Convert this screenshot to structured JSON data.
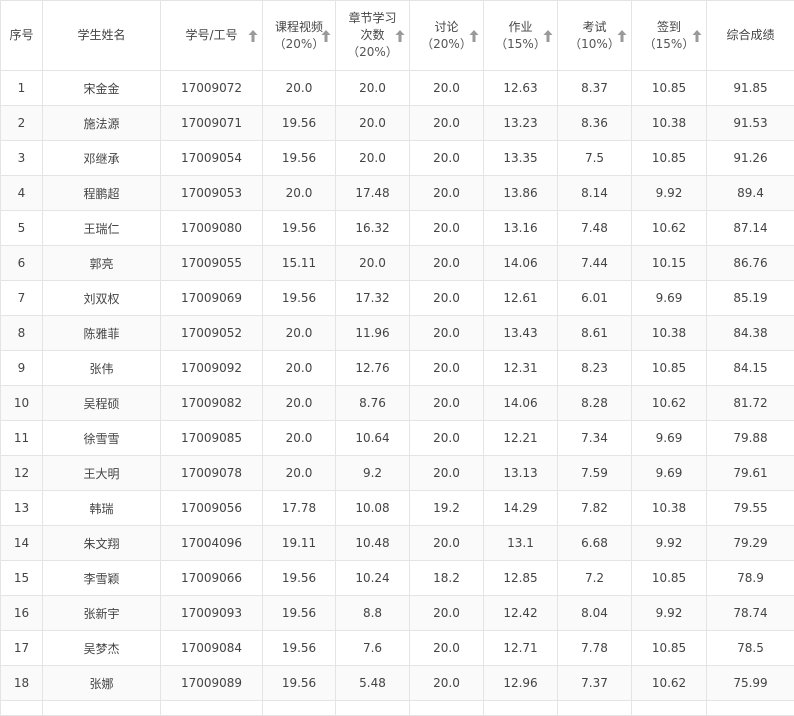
{
  "table": {
    "columns": [
      {
        "label": "序号",
        "sortable": false
      },
      {
        "label": "学生姓名",
        "sortable": false
      },
      {
        "label": "学号/工号",
        "sortable": true
      },
      {
        "label": "课程视频",
        "sub": "（20%）",
        "sortable": true
      },
      {
        "label": "章节学习次数",
        "sub": "（20%）",
        "sortable": true
      },
      {
        "label": "讨论",
        "sub": "（20%）",
        "sortable": true
      },
      {
        "label": "作业",
        "sub": "（15%）",
        "sortable": true
      },
      {
        "label": "考试",
        "sub": "（10%）",
        "sortable": true
      },
      {
        "label": "签到",
        "sub": "（15%）",
        "sortable": true
      },
      {
        "label": "综合成绩",
        "sortable": false
      }
    ],
    "rows": [
      [
        "1",
        "宋金金",
        "17009072",
        "20.0",
        "20.0",
        "20.0",
        "12.63",
        "8.37",
        "10.85",
        "91.85"
      ],
      [
        "2",
        "施法源",
        "17009071",
        "19.56",
        "20.0",
        "20.0",
        "13.23",
        "8.36",
        "10.38",
        "91.53"
      ],
      [
        "3",
        "邓继承",
        "17009054",
        "19.56",
        "20.0",
        "20.0",
        "13.35",
        "7.5",
        "10.85",
        "91.26"
      ],
      [
        "4",
        "程鹏超",
        "17009053",
        "20.0",
        "17.48",
        "20.0",
        "13.86",
        "8.14",
        "9.92",
        "89.4"
      ],
      [
        "5",
        "王瑞仁",
        "17009080",
        "19.56",
        "16.32",
        "20.0",
        "13.16",
        "7.48",
        "10.62",
        "87.14"
      ],
      [
        "6",
        "郭亮",
        "17009055",
        "15.11",
        "20.0",
        "20.0",
        "14.06",
        "7.44",
        "10.15",
        "86.76"
      ],
      [
        "7",
        "刘双权",
        "17009069",
        "19.56",
        "17.32",
        "20.0",
        "12.61",
        "6.01",
        "9.69",
        "85.19"
      ],
      [
        "8",
        "陈雅菲",
        "17009052",
        "20.0",
        "11.96",
        "20.0",
        "13.43",
        "8.61",
        "10.38",
        "84.38"
      ],
      [
        "9",
        "张伟",
        "17009092",
        "20.0",
        "12.76",
        "20.0",
        "12.31",
        "8.23",
        "10.85",
        "84.15"
      ],
      [
        "10",
        "吴程硕",
        "17009082",
        "20.0",
        "8.76",
        "20.0",
        "14.06",
        "8.28",
        "10.62",
        "81.72"
      ],
      [
        "11",
        "徐雪雪",
        "17009085",
        "20.0",
        "10.64",
        "20.0",
        "12.21",
        "7.34",
        "9.69",
        "79.88"
      ],
      [
        "12",
        "王大明",
        "17009078",
        "20.0",
        "9.2",
        "20.0",
        "13.13",
        "7.59",
        "9.69",
        "79.61"
      ],
      [
        "13",
        "韩瑞",
        "17009056",
        "17.78",
        "10.08",
        "19.2",
        "14.29",
        "7.82",
        "10.38",
        "79.55"
      ],
      [
        "14",
        "朱文翔",
        "17004096",
        "19.11",
        "10.48",
        "20.0",
        "13.1",
        "6.68",
        "9.92",
        "79.29"
      ],
      [
        "15",
        "李雪颖",
        "17009066",
        "19.56",
        "10.24",
        "18.2",
        "12.85",
        "7.2",
        "10.85",
        "78.9"
      ],
      [
        "16",
        "张新宇",
        "17009093",
        "19.56",
        "8.8",
        "20.0",
        "12.42",
        "8.04",
        "9.92",
        "78.74"
      ],
      [
        "17",
        "吴梦杰",
        "17009084",
        "19.56",
        "7.6",
        "20.0",
        "12.71",
        "7.78",
        "10.85",
        "78.5"
      ],
      [
        "18",
        "张娜",
        "17009089",
        "19.56",
        "5.48",
        "20.0",
        "12.96",
        "7.37",
        "10.62",
        "75.99"
      ]
    ]
  },
  "icons": {
    "sort": "sort-arrow-up-icon"
  },
  "colors": {
    "border": "#e4e4e4",
    "text": "#444444",
    "sort_icon": "#9a9a9a"
  }
}
